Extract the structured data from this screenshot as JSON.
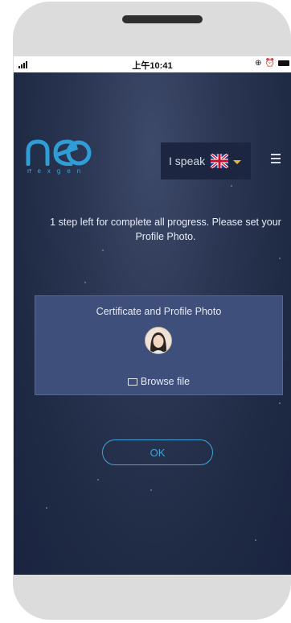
{
  "status_bar": {
    "time": "上午10:41",
    "icons": [
      "signal-icon",
      "orientation-lock-icon",
      "alarm-icon",
      "battery-icon"
    ]
  },
  "header": {
    "logo_text": "neo",
    "logo_subtext": "nexgen",
    "language_label": "I speak",
    "language_flag": "uk-flag-icon",
    "menu_icon": "hamburger-menu-icon"
  },
  "main": {
    "message": "1 step left for complete all progress. Please set your Profile Photo.",
    "card": {
      "title": "Certificate and Profile Photo",
      "avatar_icon": "profile-photo",
      "browse_label": "Browse file"
    },
    "ok_label": "OK"
  },
  "colors": {
    "accent": "#3fa4d8",
    "card_bg": "#3e4f7c",
    "screen_bg": "#2c3754",
    "caret": "#e3b53a"
  }
}
